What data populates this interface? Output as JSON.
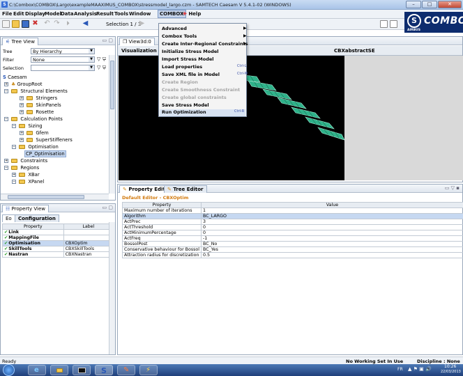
{
  "window": {
    "title": "C:\\Combox\\COMBOX\\Largo\\exampleMAAXIMUS_COMBOX\\stressmodel_largo.czm - SAMTECH Caesam V 5.4.1-02 (WINDOWS)",
    "app_icon": "S"
  },
  "menubar": {
    "items": [
      "File",
      "Edit",
      "Display",
      "Model",
      "Data",
      "Analysis",
      "Result",
      "Tools",
      "Window",
      "COMBOX",
      "Help"
    ]
  },
  "toolbar": {
    "selection_label": "Selection",
    "selection_value": "1 / 1"
  },
  "brand": {
    "logo_letter": "S",
    "name": "COMBOX",
    "sub": "AIRBUS"
  },
  "tree_view": {
    "title": "Tree View",
    "tree_label": "Tree",
    "tree_value": "By Hierarchy",
    "filter_label": "Filter",
    "filter_value": "None",
    "selection_label": "Selection",
    "nodes": [
      {
        "label": "Caesam",
        "exp": ""
      },
      {
        "label": "GroupRoot",
        "exp": "+"
      },
      {
        "label": "Structural Elements",
        "exp": "−"
      },
      {
        "label": "Stringers",
        "exp": "+"
      },
      {
        "label": "SkinPanels",
        "exp": "+"
      },
      {
        "label": "Rosette",
        "exp": "+"
      },
      {
        "label": "Calculation Points",
        "exp": "−"
      },
      {
        "label": "Sizing",
        "exp": "−"
      },
      {
        "label": "Gfem",
        "exp": "+"
      },
      {
        "label": "SuperStiffeners",
        "exp": "+"
      },
      {
        "label": "Optimisation",
        "exp": "−"
      },
      {
        "label": "CP_Optimisation",
        "exp": ""
      },
      {
        "label": "Constraints",
        "exp": "+"
      },
      {
        "label": "Regions",
        "exp": "−"
      },
      {
        "label": "XBar",
        "exp": "+"
      },
      {
        "label": "XPanel",
        "exp": "−"
      }
    ]
  },
  "property_view": {
    "title": "Property View",
    "tabs": [
      "Eo",
      "Configuration"
    ],
    "headers": [
      "Property",
      "Label"
    ],
    "rows": [
      {
        "property": "Link",
        "label": ""
      },
      {
        "property": "MappingFile",
        "label": ""
      },
      {
        "property": "Optimisation",
        "label": "CBXOptim"
      },
      {
        "property": "SkillTools",
        "label": "CBXSkillTools"
      },
      {
        "property": "Nastran",
        "label": "CBXNastran"
      }
    ]
  },
  "view3d": {
    "tab": "View3d:0",
    "visualization_label": "Visualization",
    "model_name": "CBXabstractSE"
  },
  "combox_menu": {
    "items": [
      {
        "label": "Advanced",
        "shortcut": "",
        "submenu": true,
        "disabled": false
      },
      {
        "label": "Combox Tools",
        "shortcut": "",
        "submenu": true,
        "disabled": false
      },
      {
        "label": "Create Inter-Regional Constraints",
        "shortcut": "",
        "submenu": true,
        "disabled": false
      },
      {
        "label": "Initialize Stress Model",
        "shortcut": "",
        "submenu": false,
        "disabled": false
      },
      {
        "label": "Import Stress Model",
        "shortcut": "",
        "submenu": false,
        "disabled": false
      },
      {
        "label": "Load properties",
        "shortcut": "Ctrl-L",
        "submenu": false,
        "disabled": false
      },
      {
        "label": "Save XML file in Model",
        "shortcut": "Ctrl-M",
        "submenu": false,
        "disabled": false
      },
      {
        "label": "Create Region",
        "shortcut": "",
        "submenu": false,
        "disabled": true
      },
      {
        "label": "Create Smoothness Constraint",
        "shortcut": "",
        "submenu": false,
        "disabled": true
      },
      {
        "label": "Create global constraints",
        "shortcut": "",
        "submenu": false,
        "disabled": true
      },
      {
        "label": "Save Stress Model",
        "shortcut": "",
        "submenu": false,
        "disabled": false
      },
      {
        "label": "Run Optimization",
        "shortcut": "Ctrl-R",
        "submenu": false,
        "disabled": false
      }
    ]
  },
  "property_editor": {
    "tabs": [
      "Property Editor",
      "Tree Editor"
    ],
    "subtitle": "Default Editor - CBXOptim",
    "headers": [
      "Property",
      "Value"
    ],
    "rows": [
      {
        "property": "Maximum number of iterations",
        "value": "1"
      },
      {
        "property": "Algorithm",
        "value": "BC_LARGO"
      },
      {
        "property": "ActPrec",
        "value": "3"
      },
      {
        "property": "ActThreshold",
        "value": "0"
      },
      {
        "property": "ActMinimumPercentage",
        "value": "0"
      },
      {
        "property": "ActFreq",
        "value": "-1"
      },
      {
        "property": "BossolPost",
        "value": "BC_No"
      },
      {
        "property": "Conservative behaviour for Bossol",
        "value": "BC_Yes"
      },
      {
        "property": "Attraction radius for discretization",
        "value": "0.5"
      }
    ]
  },
  "status": {
    "left": "Ready",
    "working_set": "No Working Set In Use",
    "discipline": "Discipline : None"
  },
  "taskbar": {
    "lang": "FR",
    "time": "10:26",
    "date": "22/03/2013"
  }
}
